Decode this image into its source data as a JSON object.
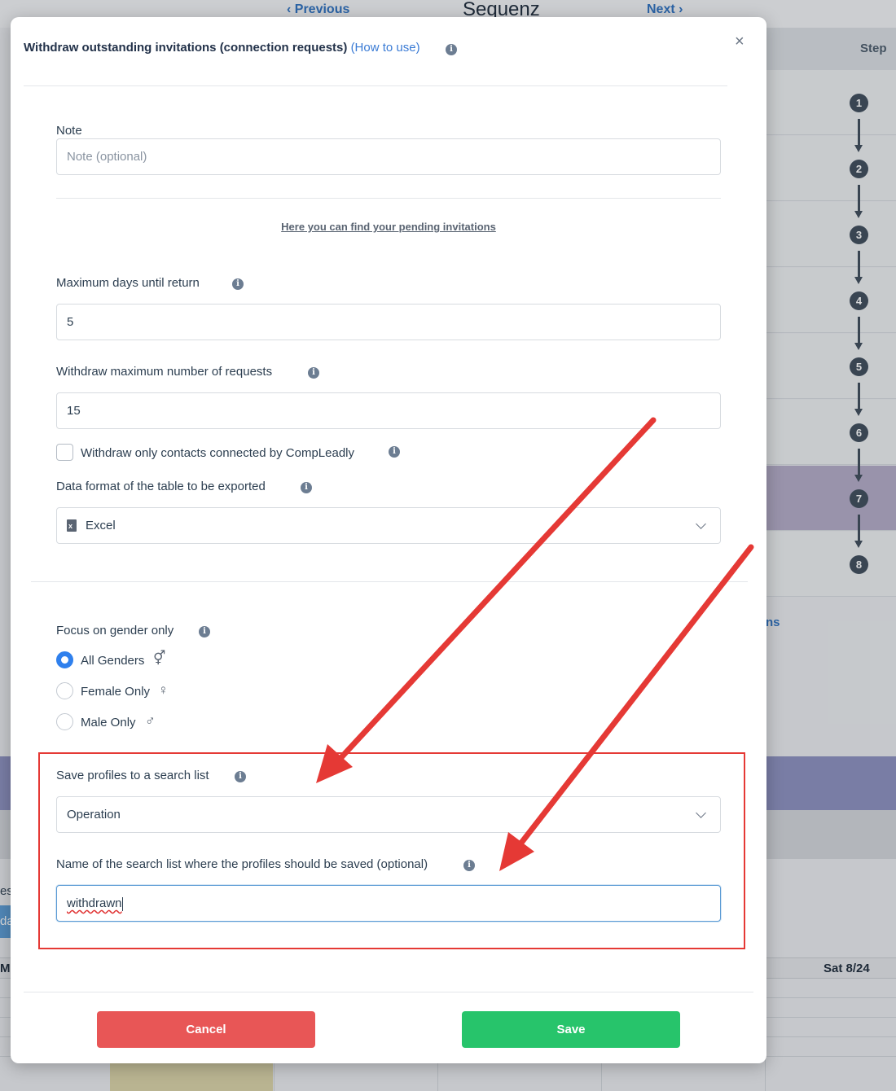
{
  "background": {
    "prev_label": "Previous",
    "app_title": "Sequenz",
    "next_label": "Next",
    "step_header": "Step",
    "steps": [
      "1",
      "2",
      "3",
      "4",
      "5",
      "6",
      "7",
      "8"
    ],
    "partial_link": "ns",
    "partial_es": "es:",
    "partial_btn": "da",
    "partial_m": "M",
    "sat_header": "Sat 8/24"
  },
  "modal": {
    "title": "Withdraw outstanding invitations (connection requests)",
    "how_to_use": "(How to use)",
    "close_symbol": "×",
    "note": {
      "label": "Note",
      "placeholder": "Note (optional)"
    },
    "pending_link": "Here you can find your pending invitations",
    "max_days": {
      "label": "Maximum days until return",
      "value": "5"
    },
    "max_requests": {
      "label": "Withdraw maximum number of requests",
      "value": "15"
    },
    "only_compleadly": {
      "label": "Withdraw only contacts connected by CompLeadly",
      "checked": false
    },
    "data_format": {
      "label": "Data format of the table to be exported",
      "value": "Excel",
      "icon": "excel-file-icon"
    },
    "gender": {
      "label": "Focus on gender only",
      "options": [
        {
          "label": "All Genders",
          "symbol": "⚥",
          "checked": true
        },
        {
          "label": "Female Only",
          "symbol": "♀",
          "checked": false
        },
        {
          "label": "Male Only",
          "symbol": "♂",
          "checked": false
        }
      ]
    },
    "search_list": {
      "label": "Save profiles to a search list",
      "value": "Operation"
    },
    "search_list_name": {
      "label": "Name of the search list where the profiles should be saved (optional)",
      "value": "withdrawn"
    },
    "cancel_label": "Cancel",
    "save_label": "Save"
  },
  "colors": {
    "accent": "#2f80ed",
    "link": "#3a7bd5",
    "cancel": "#e85656",
    "save": "#27c46b",
    "annotation": "#e53935"
  }
}
